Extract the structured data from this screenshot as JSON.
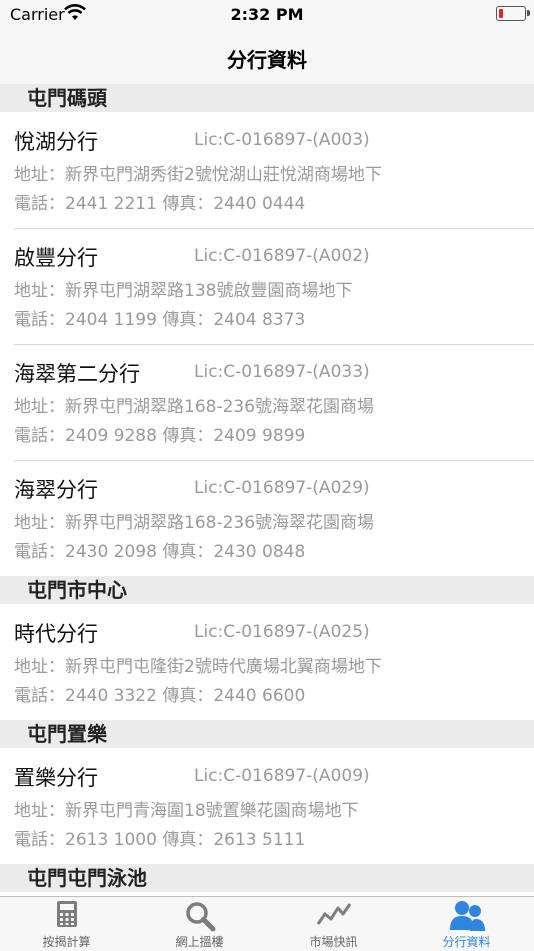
{
  "status_bar": {
    "carrier": "Carrier",
    "time": "2:32 PM"
  },
  "nav": {
    "title": "分行資料"
  },
  "sections": [
    {
      "title": "屯門碼頭",
      "branches": [
        {
          "name": "悅湖分行",
          "license": "Lic:C-016897-(A003)",
          "address": "地址：新界屯門湖秀街2號悅湖山莊悅湖商場地下",
          "phone": "電話：2441 2211  傳真：2440 0444"
        },
        {
          "name": "啟豐分行",
          "license": "Lic:C-016897-(A002)",
          "address": "地址：新界屯門湖翠路138號啟豐園商場地下",
          "phone": "電話：2404 1199  傳真：2404 8373"
        },
        {
          "name": "海翠第二分行",
          "license": "Lic:C-016897-(A033)",
          "address": "地址：新界屯門湖翠路168-236號海翠花園商場",
          "phone": "電話：2409 9288 傳真：2409 9899"
        },
        {
          "name": "海翠分行",
          "license": "Lic:C-016897-(A029)",
          "address": "地址：新界屯門湖翠路168-236號海翠花園商場",
          "phone": "電話：2430 2098 傳真：2430 0848"
        }
      ]
    },
    {
      "title": "屯門市中心",
      "branches": [
        {
          "name": "時代分行",
          "license": "Lic:C-016897-(A025)",
          "address": "地址：新界屯門屯隆街2號時代廣場北翼商場地下",
          "phone": "電話：2440 3322 傳真：2440 6600"
        }
      ]
    },
    {
      "title": "屯門置樂",
      "branches": [
        {
          "name": "置樂分行",
          "license": "Lic:C-016897-(A009)",
          "address": "地址：新界屯門青海圍18號置樂花園商場地下",
          "phone": "電話：2613 1000  傳真：2613 5111"
        }
      ]
    },
    {
      "title": "屯門屯門泳池",
      "branches": []
    }
  ],
  "tabs": [
    {
      "label": "按揭計算",
      "icon": "calculator-icon",
      "active": false
    },
    {
      "label": "網上搵樓",
      "icon": "magnifier-icon",
      "active": false
    },
    {
      "label": "市場快訊",
      "icon": "trend-chart-icon",
      "active": false
    },
    {
      "label": "分行資料",
      "icon": "people-icon",
      "active": true
    }
  ],
  "colors": {
    "active_tab": "#2f86e0",
    "inactive_tab": "#666666",
    "section_bg": "#ebebeb",
    "secondary_text": "#9a9a9a",
    "battery_low": "#e0262b"
  }
}
